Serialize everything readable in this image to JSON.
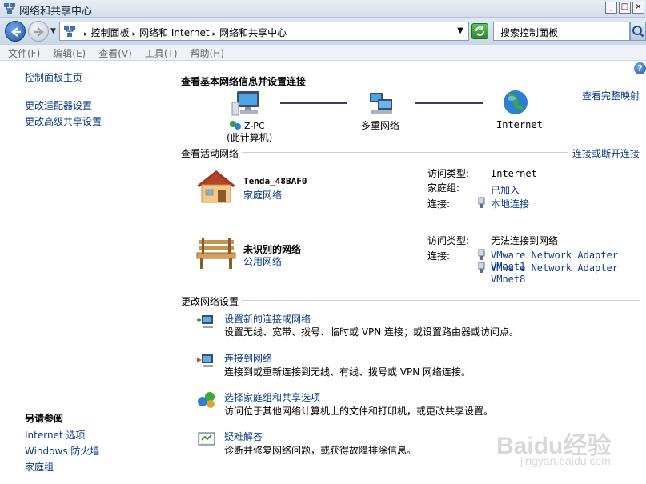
{
  "window": {
    "title": "网络和共享中心",
    "buttons": [
      "_",
      "□",
      "×"
    ]
  },
  "address": {
    "crumbs": [
      "控制面板",
      "网络和 Internet",
      "网络和共享中心"
    ],
    "search_placeholder": "搜索控制面板"
  },
  "menu": [
    "文件(F)",
    "编辑(E)",
    "查看(V)",
    "工具(T)",
    "帮助(H)"
  ],
  "left": {
    "home": "控制面板主页",
    "adapter": "更改适配器设置",
    "advanced": "更改高级共享设置",
    "see_also_title": "另请参阅",
    "see_also": [
      "Internet 选项",
      "Windows 防火墙",
      "家庭组"
    ]
  },
  "main": {
    "heading": "查看基本网络信息并设置连接",
    "view_full_map": "查看完整映射",
    "map": {
      "pc_line1": "Z-PC",
      "pc_line2": "(此计算机)",
      "mid": "多重网络",
      "internet": "Internet"
    },
    "active_title": "查看活动网络",
    "connect_disconnect": "连接或断开连接",
    "networks": [
      {
        "name": "Tenda_48BAF0",
        "type": "家庭网络",
        "access_label": "访问类型:",
        "access_value": "Internet",
        "homegroup_label": "家庭组:",
        "homegroup_value": "已加入",
        "conn_label": "连接:",
        "conn_values": [
          "本地连接"
        ]
      },
      {
        "name": "未识别的网络",
        "type": "公用网络",
        "access_label": "访问类型:",
        "access_value": "无法连接到网络",
        "conn_label": "连接:",
        "conn_values": [
          "VMware Network Adapter VMnet1",
          "VMware Network Adapter VMnet8"
        ]
      }
    ],
    "change_title": "更改网络设置",
    "tasks": [
      {
        "title": "设置新的连接或网络",
        "desc": "设置无线、宽带、拨号、临时或 VPN 连接；或设置路由器或访问点。",
        "icon": "new-connection-icon"
      },
      {
        "title": "连接到网络",
        "desc": "连接到或重新连接到无线、有线、拨号或 VPN 网络连接。",
        "icon": "connect-network-icon"
      },
      {
        "title": "选择家庭组和共享选项",
        "desc": "访问位于其他网络计算机上的文件和打印机，或更改共享设置。",
        "icon": "homegroup-icon"
      },
      {
        "title": "疑难解答",
        "desc": "诊断并修复网络问题，或获得故障排除信息。",
        "icon": "troubleshoot-icon"
      }
    ]
  },
  "watermark": {
    "brand": "Baidu经验",
    "url": "jingyan.baidu.com"
  },
  "colors": {
    "link": "#0b3b8c",
    "menu_text": "#6b6b6b"
  }
}
